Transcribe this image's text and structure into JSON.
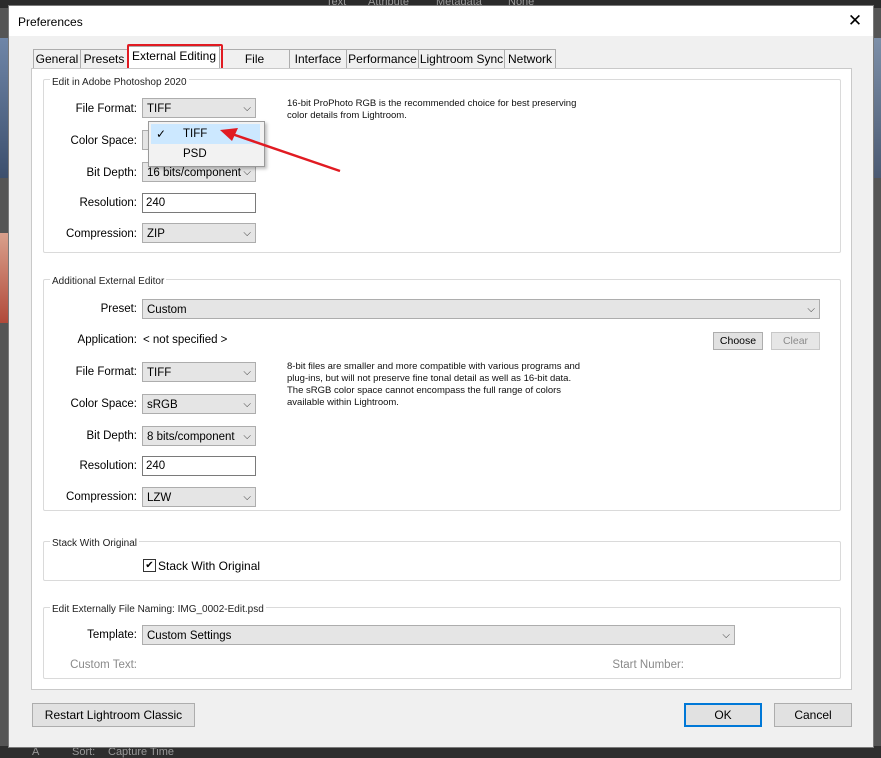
{
  "background": {
    "top_items": [
      "Text",
      "Attribute",
      "Metadata",
      "None"
    ],
    "bottom_sort_label": "Sort:",
    "bottom_sort_value": "Capture Time"
  },
  "window": {
    "title": "Preferences"
  },
  "tabs": [
    "General",
    "Presets",
    "External Editing",
    "File Handling",
    "Interface",
    "Performance",
    "Lightroom Sync",
    "Network"
  ],
  "active_tab": "External Editing",
  "photoshop": {
    "group_label": "Edit in Adobe Photoshop 2020",
    "file_format_label": "File Format:",
    "file_format_value": "TIFF",
    "color_space_label": "Color Space:",
    "bit_depth_label": "Bit Depth:",
    "bit_depth_value": "16 bits/component",
    "resolution_label": "Resolution:",
    "resolution_value": "240",
    "compression_label": "Compression:",
    "compression_value": "ZIP",
    "note": "16-bit ProPhoto RGB is the recommended choice for best preserving color details from Lightroom.",
    "dropdown_options": [
      "TIFF",
      "PSD"
    ],
    "dropdown_selected": "TIFF"
  },
  "additional": {
    "group_label": "Additional External Editor",
    "preset_label": "Preset:",
    "preset_value": "Custom",
    "application_label": "Application:",
    "application_value": "< not specified >",
    "choose_label": "Choose",
    "clear_label": "Clear",
    "file_format_label": "File Format:",
    "file_format_value": "TIFF",
    "color_space_label": "Color Space:",
    "color_space_value": "sRGB",
    "bit_depth_label": "Bit Depth:",
    "bit_depth_value": "8 bits/component",
    "resolution_label": "Resolution:",
    "resolution_value": "240",
    "compression_label": "Compression:",
    "compression_value": "LZW",
    "note": "8-bit files are smaller and more compatible with various programs and plug-ins, but will not preserve fine tonal detail as well as 16-bit data. The sRGB color space cannot encompass the full range of colors available within Lightroom."
  },
  "stack": {
    "group_label": "Stack With Original",
    "checkbox_label": "Stack With Original",
    "checked": true
  },
  "naming": {
    "group_label": "Edit Externally File Naming:  IMG_0002-Edit.psd",
    "template_label": "Template:",
    "template_value": "Custom Settings",
    "custom_text_label": "Custom Text:",
    "start_number_label": "Start Number:"
  },
  "footer": {
    "restart_label": "Restart Lightroom Classic",
    "ok_label": "OK",
    "cancel_label": "Cancel"
  },
  "colors": {
    "highlight": "#e11b22",
    "selection": "#cce8ff",
    "default_button": "#0078d7"
  }
}
